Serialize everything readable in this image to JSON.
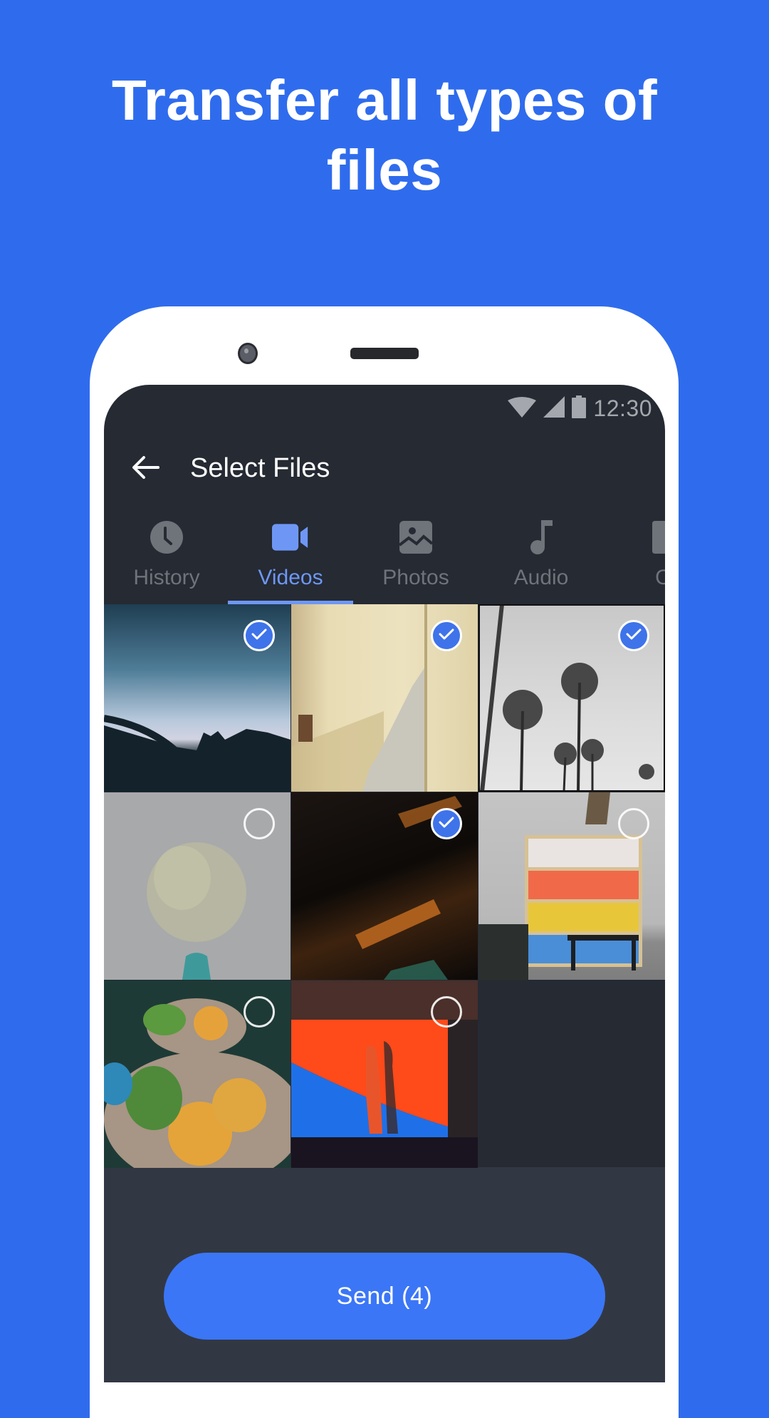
{
  "headline": {
    "line1": "Transfer all types of",
    "line2": "files"
  },
  "status_bar": {
    "time": "12:30",
    "icons": [
      "wifi-icon",
      "cell-signal-icon",
      "battery-icon"
    ]
  },
  "toolbar": {
    "back_icon": "arrow-back-icon",
    "title": "Select Files"
  },
  "tabs": [
    {
      "label": "History",
      "icon": "clock-icon",
      "active": false
    },
    {
      "label": "Videos",
      "icon": "videocam-icon",
      "active": true
    },
    {
      "label": "Photos",
      "icon": "image-icon",
      "active": false
    },
    {
      "label": "Audio",
      "icon": "music-note-icon",
      "active": false
    },
    {
      "label": "Ot",
      "icon": "file-icon",
      "active": false
    }
  ],
  "grid": {
    "items": [
      {
        "subject": "city skyline silhouette at dusk",
        "selected": true
      },
      {
        "subject": "stucco staircase",
        "selected": true
      },
      {
        "subject": "palm trees black and white",
        "selected": true
      },
      {
        "subject": "dried flowers in vase",
        "selected": false
      },
      {
        "subject": "dark interior with sunlight",
        "selected": true
      },
      {
        "subject": "colorful bookshelf lounge",
        "selected": false
      },
      {
        "subject": "eggs benedict brunch",
        "selected": false
      },
      {
        "subject": "person against orange and blue wall",
        "selected": false
      }
    ]
  },
  "send_button": {
    "label": "Send (4)"
  },
  "colors": {
    "background": "#2f6ced",
    "screen": "#252a33",
    "accent": "#3b76f6",
    "tab_active": "#6e97f5",
    "tab_inactive": "#6f737a"
  }
}
